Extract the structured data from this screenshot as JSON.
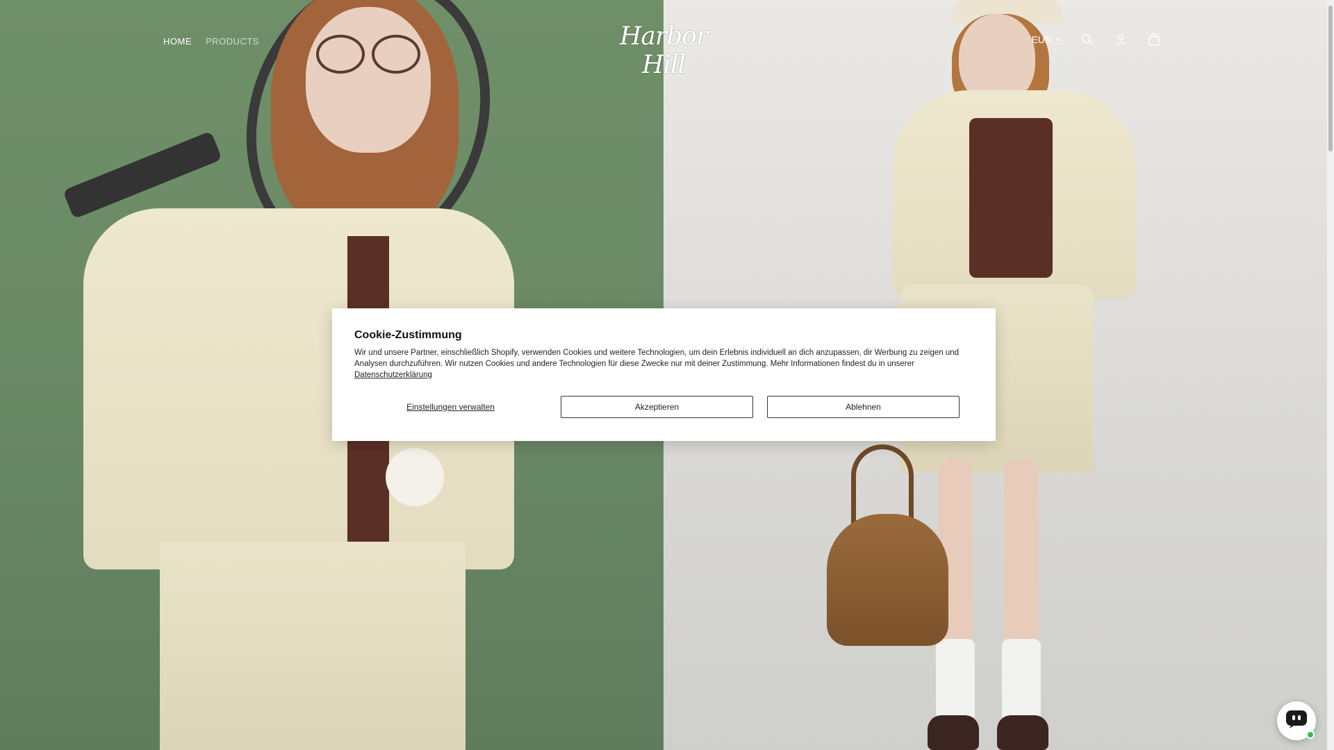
{
  "header": {
    "nav": [
      {
        "label": "HOME"
      },
      {
        "label": "PRODUCTS"
      }
    ],
    "logo_text": "Harbor Hill",
    "currency": "EUR",
    "icons": [
      "search-icon",
      "account-icon",
      "cart-icon"
    ]
  },
  "cookie": {
    "title": "Cookie-Zustimmung",
    "body": "Wir und unsere Partner, einschließlich Shopify, verwenden Cookies und weitere Technologien, um dein Erlebnis individuell an dich anzupassen, dir Werbung zu zeigen und Analysen durchzuführen. Wir nutzen Cookies und andere Technologien für diese Zwecke nur mit deiner Zustimmung. Mehr Informationen findest du in unserer",
    "privacy_link": "Datenschutzerklärung",
    "manage_label": "Einstellungen verwalten",
    "accept_label": "Akzeptieren",
    "decline_label": "Ablehnen"
  },
  "colors": {
    "left_panel": "#6f8f69",
    "right_panel": "#e3e2de",
    "chat_online": "#2fbf4a"
  }
}
